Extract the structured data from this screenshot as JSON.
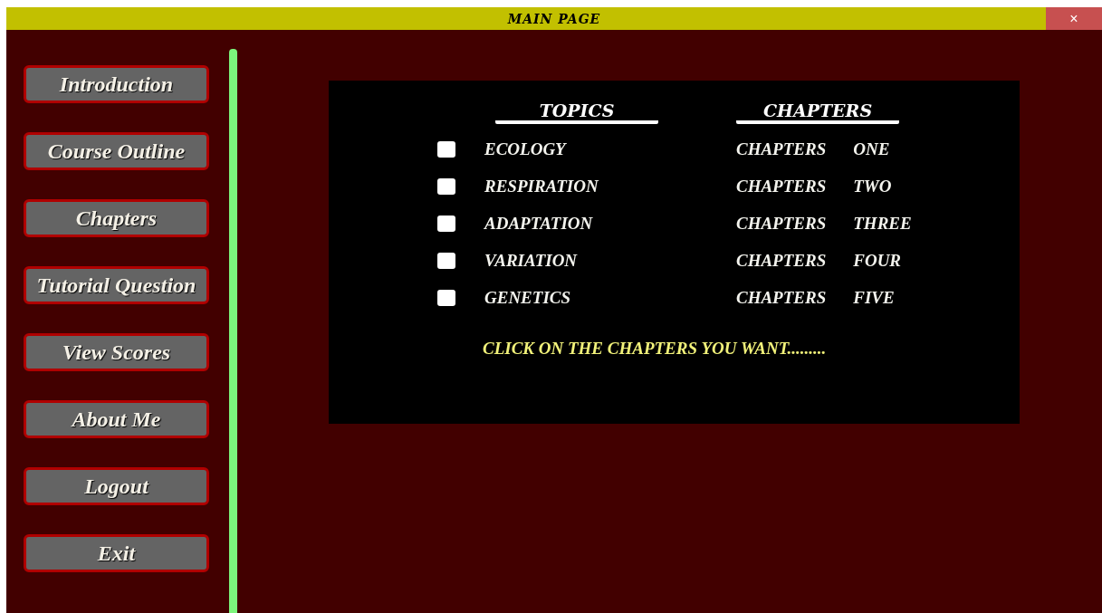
{
  "window": {
    "title": "MAIN PAGE",
    "close": "×"
  },
  "sidebar": {
    "items": [
      {
        "label": "Introduction"
      },
      {
        "label": "Course Outline"
      },
      {
        "label": "Chapters"
      },
      {
        "label": "Tutorial Question"
      },
      {
        "label": "View Scores"
      },
      {
        "label": "About Me"
      },
      {
        "label": "Logout"
      },
      {
        "label": "Exit"
      }
    ]
  },
  "panel": {
    "headers": [
      "TOPICS",
      "CHAPTERS"
    ],
    "rows": [
      {
        "checked": false,
        "topic": "ECOLOGY",
        "chapter": "CHAPTERS",
        "number": "ONE"
      },
      {
        "checked": false,
        "topic": "RESPIRATION",
        "chapter": "CHAPTERS",
        "number": "TWO"
      },
      {
        "checked": false,
        "topic": "ADAPTATION",
        "chapter": "CHAPTERS",
        "number": "THREE"
      },
      {
        "checked": false,
        "topic": "VARIATION",
        "chapter": "CHAPTERS",
        "number": "FOUR"
      },
      {
        "checked": false,
        "topic": "GENETICS",
        "chapter": "CHAPTERS",
        "number": "FIVE"
      }
    ],
    "hint": "CLICK ON THE CHAPTERS YOU WANT........."
  }
}
